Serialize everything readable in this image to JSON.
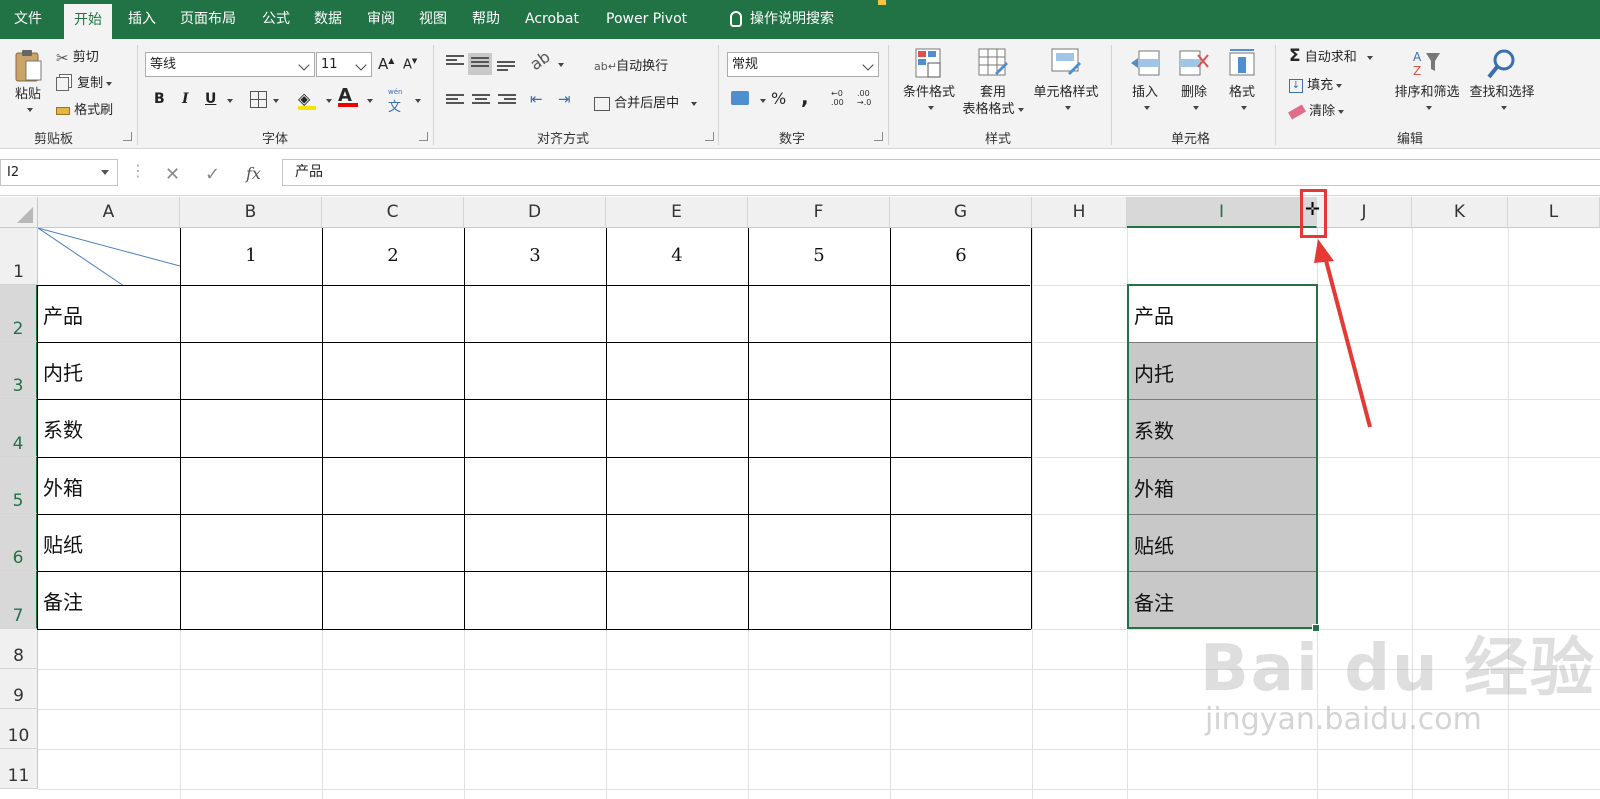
{
  "ribbon_tabs": {
    "file": "文件",
    "home": "开始",
    "insert": "插入",
    "page_layout": "页面布局",
    "formulas": "公式",
    "data": "数据",
    "review": "审阅",
    "view": "视图",
    "help": "帮助",
    "acrobat": "Acrobat",
    "power_pivot": "Power Pivot",
    "tell_me": "操作说明搜索"
  },
  "clipboard": {
    "paste": "粘贴",
    "cut": "剪切",
    "copy": "复制",
    "format_painter": "格式刷",
    "label": "剪贴板"
  },
  "font": {
    "name": "等线",
    "size": "11",
    "label": "字体",
    "bold": "B",
    "italic": "I",
    "underline": "U",
    "grow": "A",
    "shrink": "A",
    "color_letter": "A",
    "phonetic": "文"
  },
  "alignment": {
    "wrap_text": "自动换行",
    "merge_center": "合并后居中",
    "label": "对齐方式"
  },
  "number": {
    "format": "常规",
    "label": "数字",
    "percent": "%",
    "comma": ","
  },
  "styles": {
    "conditional": "条件格式",
    "table_1": "套用",
    "table_2": "表格格式",
    "cell_styles": "单元格样式",
    "label": "样式"
  },
  "cells": {
    "insert": "插入",
    "delete": "删除",
    "format": "格式",
    "label": "单元格"
  },
  "editing": {
    "autosum": "自动求和",
    "fill": "填充",
    "clear": "清除",
    "sort_filter": "排序和筛选",
    "find_select": "查找和选择",
    "label": "编辑"
  },
  "formula_bar": {
    "name_box": "I2",
    "content": "产品",
    "fx": "fx"
  },
  "columns": [
    "A",
    "B",
    "C",
    "D",
    "E",
    "F",
    "G",
    "H",
    "I",
    "J",
    "K",
    "L"
  ],
  "rows": [
    "1",
    "2",
    "3",
    "4",
    "5",
    "6",
    "7",
    "8",
    "9",
    "10",
    "11"
  ],
  "header_numbers": [
    "1",
    "2",
    "3",
    "4",
    "5",
    "6"
  ],
  "row_labels": [
    "产品",
    "内托",
    "系数",
    "外箱",
    "贴纸",
    "备注"
  ],
  "column_i": [
    "产品",
    "内托",
    "系数",
    "外箱",
    "贴纸",
    "备注"
  ],
  "watermark": {
    "brand": "Bai du 经验",
    "url": "jingyan.baidu.com"
  }
}
